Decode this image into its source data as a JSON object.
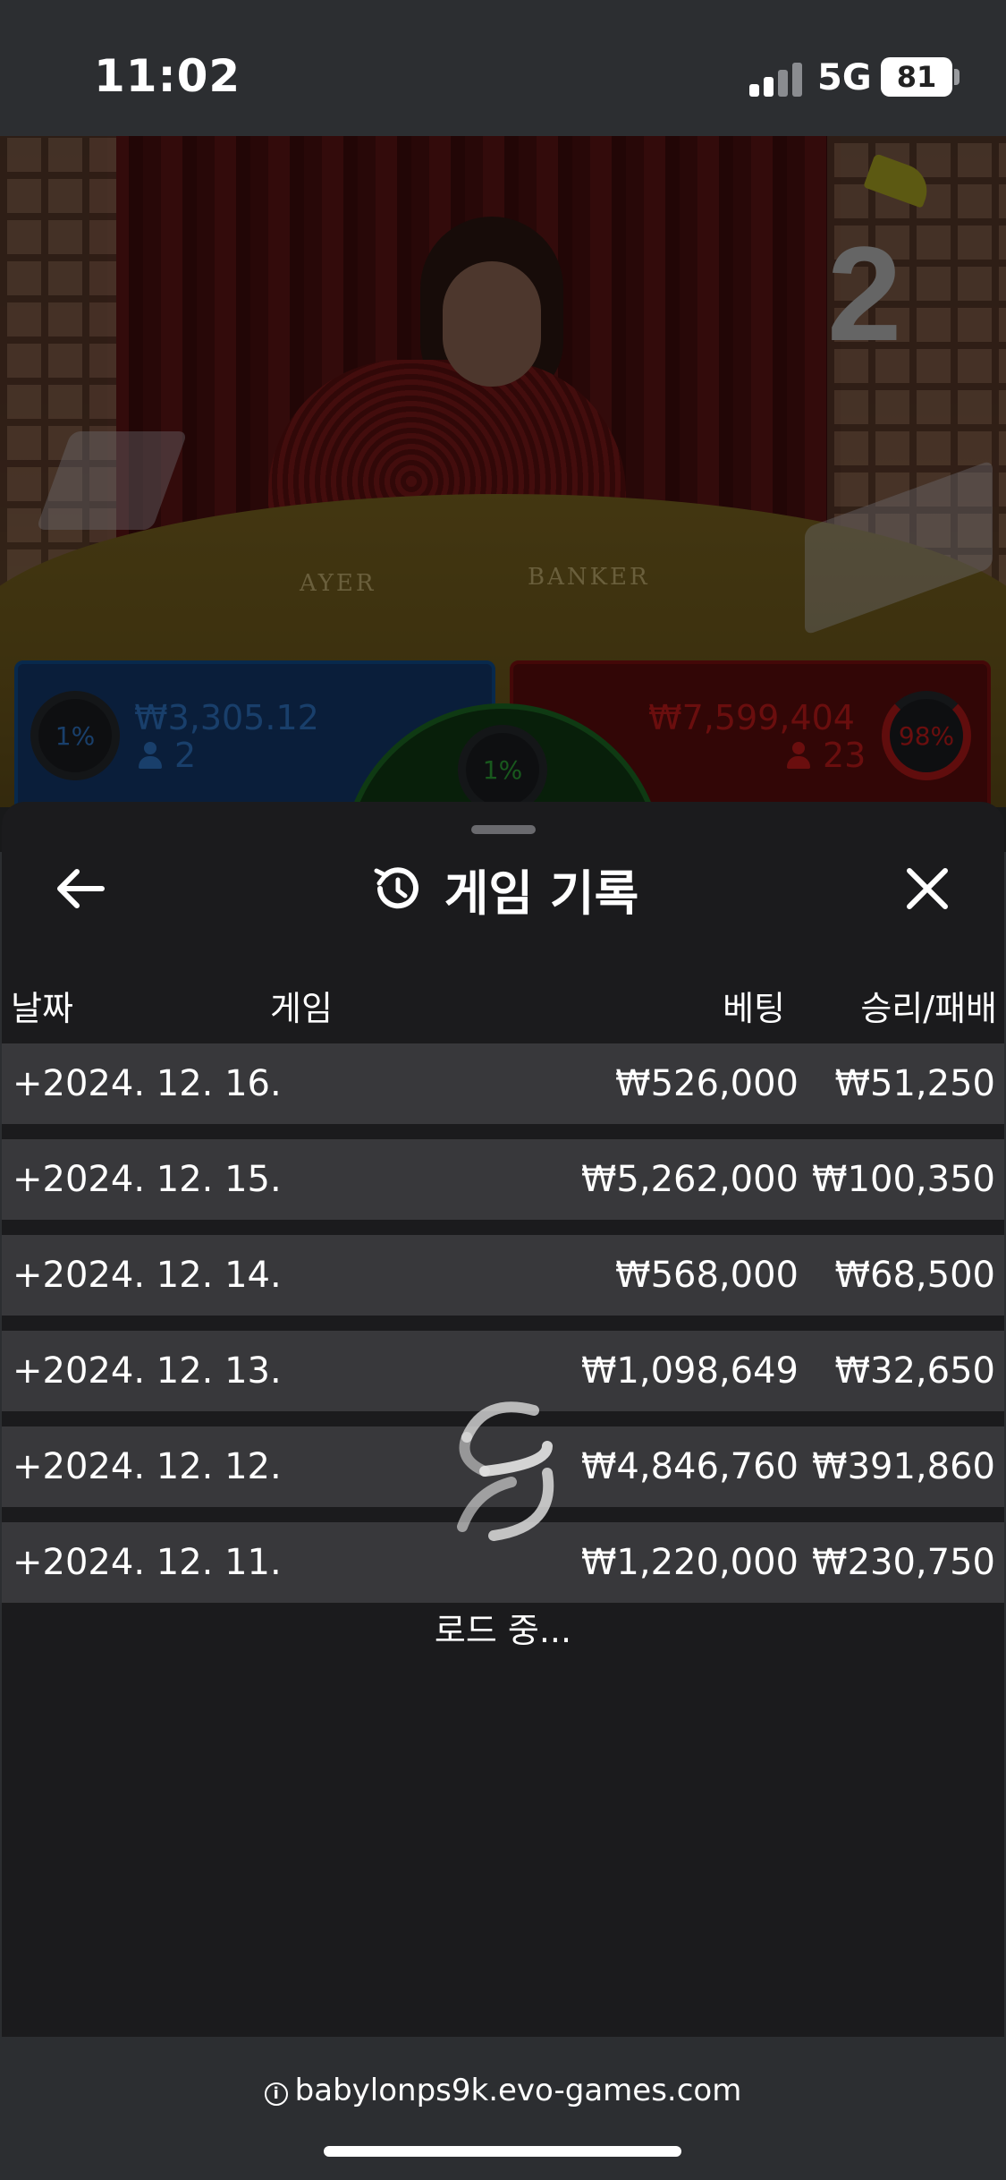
{
  "status_bar": {
    "time": "11:02",
    "network": "5G",
    "battery": "81"
  },
  "video": {
    "table_player_label": "AYER",
    "table_banker_label": "BANKER",
    "round_number": "2"
  },
  "bet_panels": {
    "player": {
      "percent": "1%",
      "amount": "₩3,305.12",
      "count": "2",
      "color": "#2f74c3"
    },
    "tie": {
      "percent": "1%",
      "color": "#2ca036"
    },
    "banker": {
      "percent": "98%",
      "amount": "₩7,599,404",
      "count": "23",
      "color": "#c21b1b"
    }
  },
  "sheet": {
    "title": "게임 기록",
    "icons": {
      "back": "arrow-left-icon",
      "title": "history-icon",
      "close": "close-icon"
    },
    "columns": {
      "date": "날짜",
      "game": "게임",
      "bet": "베팅",
      "result": "승리/패배"
    },
    "rows": [
      {
        "date": "+2024. 12. 16.",
        "bet": "₩526,000",
        "result": "₩51,250"
      },
      {
        "date": "+2024. 12. 15.",
        "bet": "₩5,262,000",
        "result": "₩100,350"
      },
      {
        "date": "+2024. 12. 14.",
        "bet": "₩568,000",
        "result": "₩68,500"
      },
      {
        "date": "+2024. 12. 13.",
        "bet": "₩1,098,649",
        "result": "₩32,650"
      },
      {
        "date": "+2024. 12. 12.",
        "bet": "₩4,846,760",
        "result": "₩391,860"
      },
      {
        "date": "+2024. 12. 11.",
        "bet": "₩1,220,000",
        "result": "₩230,750"
      }
    ],
    "loading_text": "로드 중..."
  },
  "browser": {
    "url": "babylonps9k.evo-games.com"
  }
}
